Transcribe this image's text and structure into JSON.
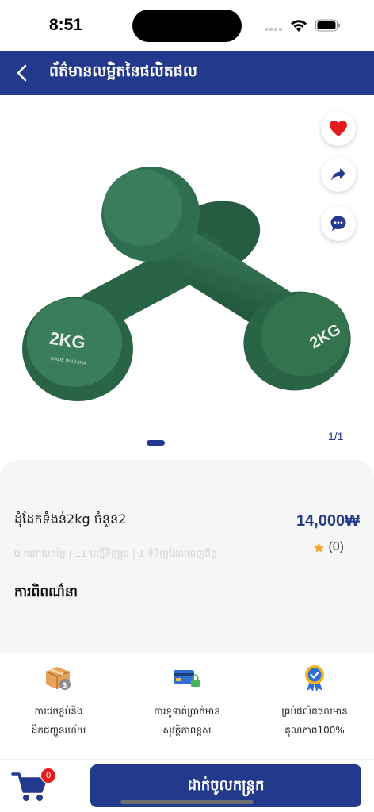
{
  "status_bar": {
    "time": "8:51"
  },
  "header": {
    "title": "ព័ត៌មានលម្អិតនៃផលិតផល"
  },
  "gallery": {
    "page_counter": "1/1",
    "current_index": 1,
    "total": 1
  },
  "actions": {
    "favorite_icon": "heart-icon",
    "share_icon": "share-icon",
    "chat_icon": "chat-icon",
    "favorite_color": "#e11d1d"
  },
  "product": {
    "name": "ដុំដែកទំងន់2kg ចំនួន2",
    "price": "14,000₩",
    "rating_count": "(0)",
    "stats": "0 ការវាយតម្លៃ | 11 បញ្ជីទិញរួច | 1 ទំនិញដែលពេញចិត្ត",
    "description_title": "ការពិពណ៌នា",
    "image_text": "2KG",
    "image_subtext": "MADE IN CHINA"
  },
  "features": [
    {
      "icon": "shipping-box-icon",
      "line1": "ការវេចខ្ចប់និង",
      "line2": "ដឹកជញ្ជូនរហ័យ"
    },
    {
      "icon": "secure-payment-icon",
      "line1": "ការទូទាត់ប្រាក់មាន",
      "line2": "សុវត្ថិភាពខ្ពស់"
    },
    {
      "icon": "quality-badge-icon",
      "line1": "គ្រប់ផលិតផលមាន",
      "line2": "គុណភាព100%"
    }
  ],
  "bottom_bar": {
    "cart_count": "0",
    "add_to_cart_label": "ដាក់ចូលកន្ត្រក"
  },
  "colors": {
    "brand": "#23398c",
    "badge": "#e21b1b",
    "star": "#f5a623",
    "dumbbell": "#2e6b4e"
  }
}
